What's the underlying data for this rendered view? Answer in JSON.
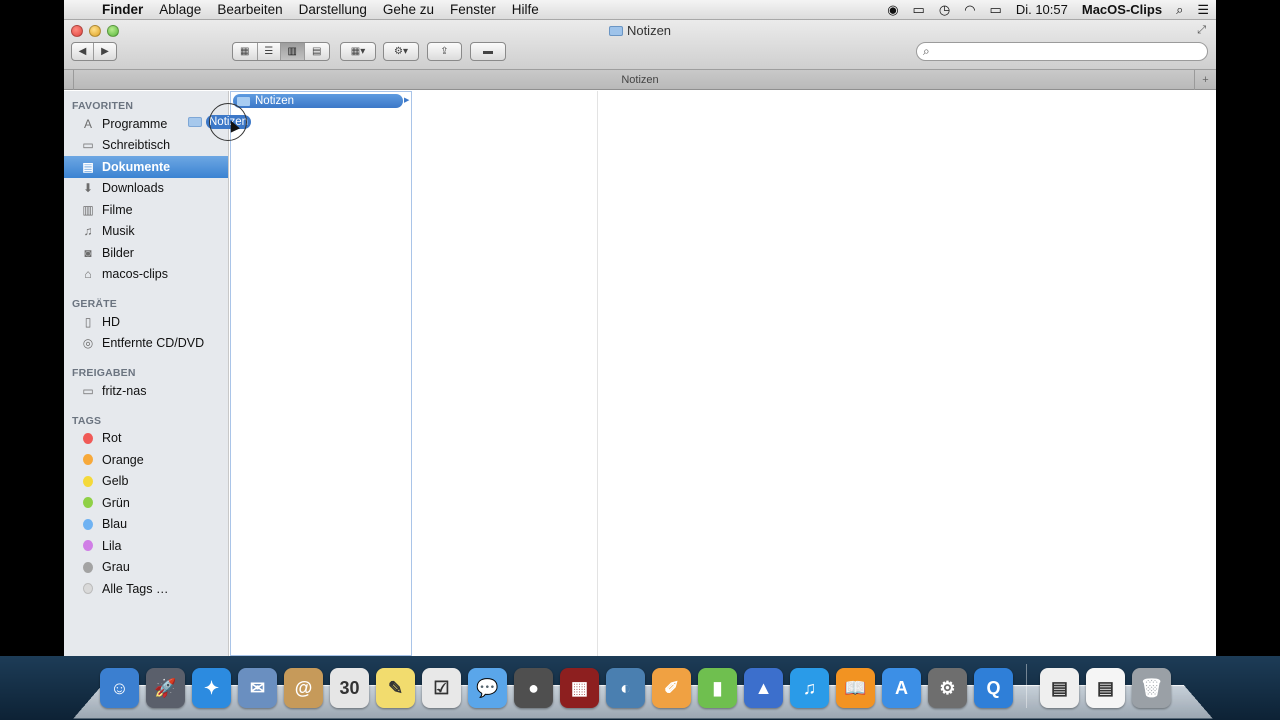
{
  "menubar": {
    "apple": "",
    "app": "Finder",
    "items": [
      "Ablage",
      "Bearbeiten",
      "Darstellung",
      "Gehe zu",
      "Fenster",
      "Hilfe"
    ],
    "clock": "Di. 10:57",
    "user": "MacOS-Clips"
  },
  "window": {
    "title": "Notizen",
    "tab_title": "Notizen",
    "search_placeholder": ""
  },
  "sidebar": {
    "favorites_header": "FAVORITEN",
    "favorites": [
      {
        "label": "Programme",
        "icon": "applications-icon"
      },
      {
        "label": "Schreibtisch",
        "icon": "desktop-icon"
      },
      {
        "label": "Dokumente",
        "icon": "documents-icon",
        "selected": true
      },
      {
        "label": "Downloads",
        "icon": "downloads-icon"
      },
      {
        "label": "Filme",
        "icon": "movies-icon"
      },
      {
        "label": "Musik",
        "icon": "music-icon"
      },
      {
        "label": "Bilder",
        "icon": "pictures-icon"
      },
      {
        "label": "macos-clips",
        "icon": "home-icon"
      }
    ],
    "devices_header": "GERÄTE",
    "devices": [
      {
        "label": "HD",
        "icon": "hard-drive-icon"
      },
      {
        "label": "Entfernte CD/DVD",
        "icon": "disc-icon"
      }
    ],
    "shared_header": "FREIGABEN",
    "shared": [
      {
        "label": "fritz-nas",
        "icon": "server-icon"
      }
    ],
    "tags_header": "TAGS",
    "tags": [
      {
        "label": "Rot",
        "color": "#f05a57"
      },
      {
        "label": "Orange",
        "color": "#f7a93a"
      },
      {
        "label": "Gelb",
        "color": "#f4d93a"
      },
      {
        "label": "Grün",
        "color": "#8fd046"
      },
      {
        "label": "Blau",
        "color": "#6fb2f2"
      },
      {
        "label": "Lila",
        "color": "#d07ee6"
      },
      {
        "label": "Grau",
        "color": "#a3a3a3"
      },
      {
        "label": "Alle Tags …",
        "color": "#d9d9d9"
      }
    ]
  },
  "columns": {
    "col1_item": "Notizen",
    "drag_label": "Notizen"
  },
  "dock": {
    "apps": [
      {
        "name": "finder-icon",
        "glyph": "☺",
        "color": "#3b7fd0"
      },
      {
        "name": "launchpad-icon",
        "glyph": "🚀",
        "color": "#5a5f6b"
      },
      {
        "name": "safari-icon",
        "glyph": "✦",
        "color": "#2c8be0"
      },
      {
        "name": "mail-icon",
        "glyph": "✉",
        "color": "#6a8fc0"
      },
      {
        "name": "contacts-icon",
        "glyph": "@",
        "color": "#c69a5a"
      },
      {
        "name": "calendar-icon",
        "glyph": "30",
        "color": "#e6e6e6"
      },
      {
        "name": "notes-icon",
        "glyph": "✎",
        "color": "#f2dc6e"
      },
      {
        "name": "reminders-icon",
        "glyph": "☑",
        "color": "#e8e8e8"
      },
      {
        "name": "messages-icon",
        "glyph": "💬",
        "color": "#5aa6ea"
      },
      {
        "name": "facetime-icon",
        "glyph": "●",
        "color": "#4f4f4f"
      },
      {
        "name": "photo-booth-icon",
        "glyph": "▦",
        "color": "#8d1f1f"
      },
      {
        "name": "iphoto-icon",
        "glyph": "◐",
        "color": "#4a7fb0"
      },
      {
        "name": "pages-icon",
        "glyph": "✐",
        "color": "#f0a142"
      },
      {
        "name": "numbers-icon",
        "glyph": "▮",
        "color": "#6fbf4f"
      },
      {
        "name": "keynote-icon",
        "glyph": "▲",
        "color": "#3c6fcc"
      },
      {
        "name": "itunes-icon",
        "glyph": "♫",
        "color": "#2a9be8"
      },
      {
        "name": "ibooks-icon",
        "glyph": "📖",
        "color": "#f29322"
      },
      {
        "name": "app-store-icon",
        "glyph": "A",
        "color": "#3c8fe6"
      },
      {
        "name": "system-preferences-icon",
        "glyph": "⚙",
        "color": "#6e6e6e"
      },
      {
        "name": "quicktime-icon",
        "glyph": "Q",
        "color": "#2f7fd8"
      }
    ],
    "docs": [
      {
        "name": "document-stack-icon",
        "glyph": "▤",
        "color": "#efefef"
      },
      {
        "name": "document-preview-icon",
        "glyph": "▤",
        "color": "#f5f5f5"
      },
      {
        "name": "trash-icon",
        "glyph": "🗑",
        "color": "#9aa0a6"
      }
    ]
  }
}
